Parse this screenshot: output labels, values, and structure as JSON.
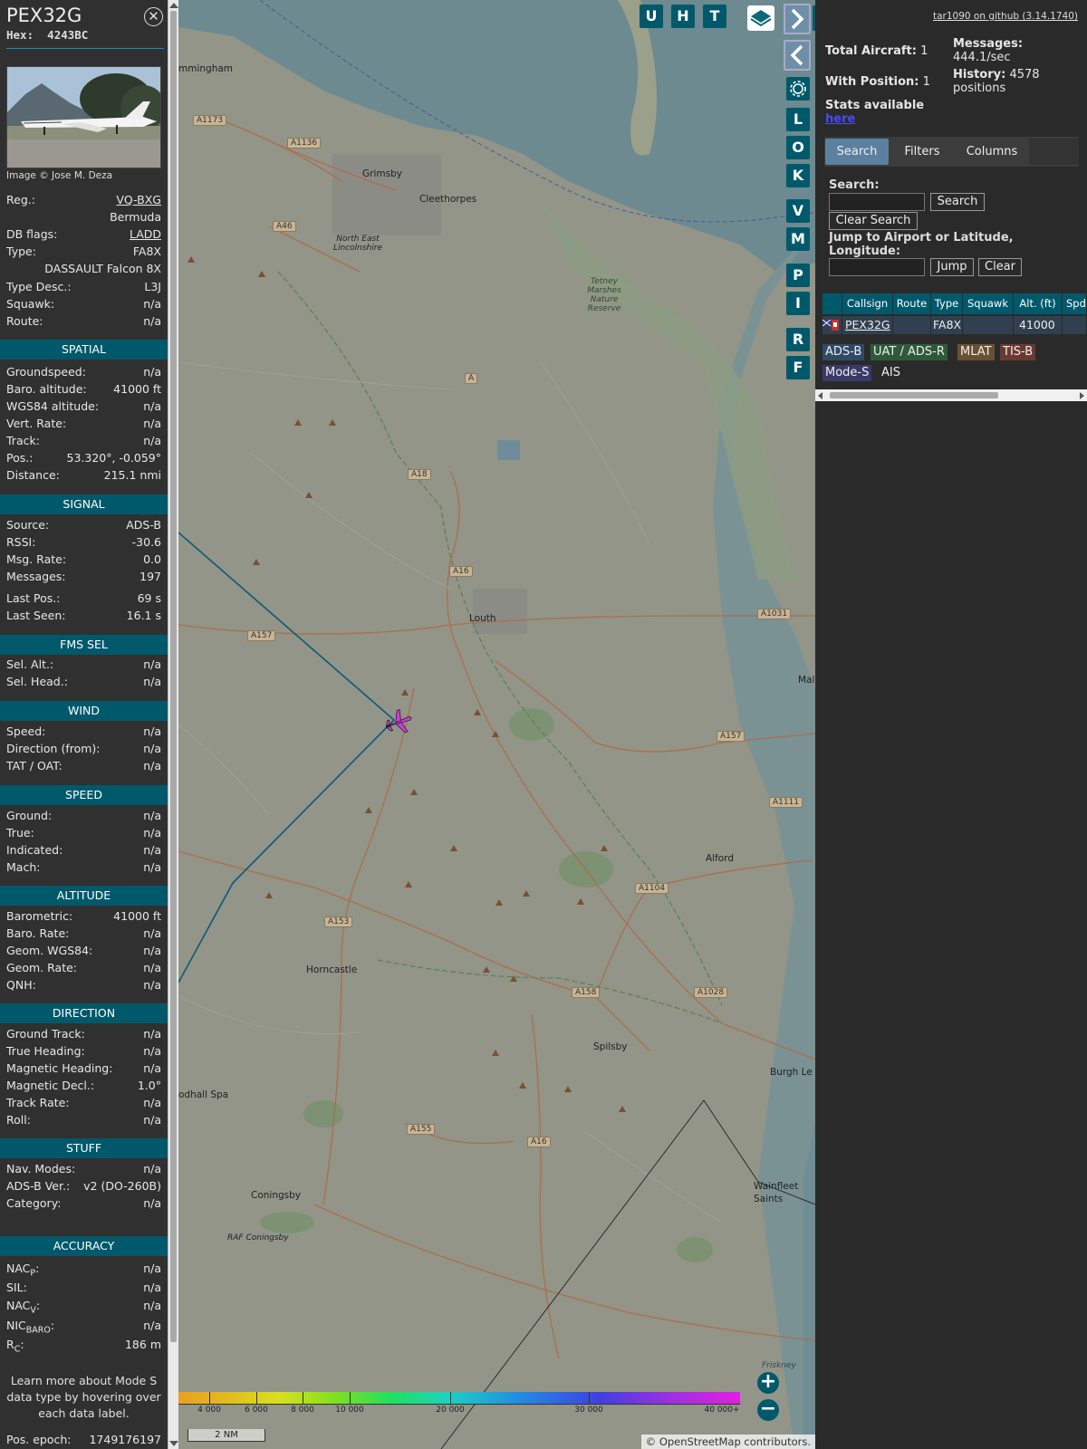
{
  "aircraft": {
    "callsign": "PEX32G",
    "hex_label": "Hex:",
    "hex": "4243BC",
    "photo_credit": "Image © Jose M. Deza",
    "close_icon": "close-circle-icon"
  },
  "info_rows_top": [
    {
      "label": "Reg.:",
      "value": "VQ-BXG",
      "link": true
    },
    {
      "label": "",
      "value": "Bermuda"
    },
    {
      "label": "DB flags:",
      "value": "LADD",
      "link": true
    },
    {
      "label": "Type:",
      "value": "FA8X"
    },
    {
      "label": "",
      "value": "DASSAULT Falcon 8X"
    },
    {
      "label": "Type Desc.:",
      "value": "L3J"
    },
    {
      "label": "Squawk:",
      "value": "n/a"
    },
    {
      "label": "Route:",
      "value": "n/a"
    }
  ],
  "sections": [
    {
      "title": "SPATIAL",
      "rows": [
        {
          "label": "Groundspeed:",
          "value": "n/a"
        },
        {
          "label": "Baro. altitude:",
          "value": "41000 ft"
        },
        {
          "label": "WGS84 altitude:",
          "value": "n/a"
        },
        {
          "label": "Vert. Rate:",
          "value": "n/a"
        },
        {
          "label": "Track:",
          "value": "n/a"
        },
        {
          "label": "Pos.:",
          "value": "53.320°, -0.059°"
        },
        {
          "label": "Distance:",
          "value": "215.1 nmi"
        }
      ]
    },
    {
      "title": "SIGNAL",
      "rows": [
        {
          "label": "Source:",
          "value": "ADS-B"
        },
        {
          "label": "RSSI:",
          "value": "-30.6"
        },
        {
          "label": "Msg. Rate:",
          "value": "0.0"
        },
        {
          "label": "Messages:",
          "value": "197"
        },
        {
          "label": "Last Pos.:",
          "value": "69 s"
        },
        {
          "label": "Last Seen:",
          "value": "16.1 s"
        }
      ]
    },
    {
      "title": "FMS SEL",
      "rows": [
        {
          "label": "Sel. Alt.:",
          "value": "n/a"
        },
        {
          "label": "Sel. Head.:",
          "value": "n/a"
        }
      ]
    },
    {
      "title": "WIND",
      "rows": [
        {
          "label": "Speed:",
          "value": "n/a"
        },
        {
          "label": "Direction (from):",
          "value": "n/a"
        },
        {
          "label": "TAT / OAT:",
          "value": "n/a"
        }
      ]
    },
    {
      "title": "SPEED",
      "rows": [
        {
          "label": "Ground:",
          "value": "n/a"
        },
        {
          "label": "True:",
          "value": "n/a"
        },
        {
          "label": "Indicated:",
          "value": "n/a"
        },
        {
          "label": "Mach:",
          "value": "n/a"
        }
      ]
    },
    {
      "title": "ALTITUDE",
      "rows": [
        {
          "label": "Barometric:",
          "value": "41000 ft"
        },
        {
          "label": "Baro. Rate:",
          "value": "n/a"
        },
        {
          "label": "Geom. WGS84:",
          "value": "n/a"
        },
        {
          "label": "Geom. Rate:",
          "value": "n/a"
        },
        {
          "label": "QNH:",
          "value": "n/a"
        }
      ]
    },
    {
      "title": "DIRECTION",
      "rows": [
        {
          "label": "Ground Track:",
          "value": "n/a"
        },
        {
          "label": "True Heading:",
          "value": "n/a"
        },
        {
          "label": "Magnetic Heading:",
          "value": "n/a"
        },
        {
          "label": "Magnetic Decl.:",
          "value": "1.0°"
        },
        {
          "label": "Track Rate:",
          "value": "n/a"
        },
        {
          "label": "Roll:",
          "value": "n/a"
        }
      ]
    },
    {
      "title": "STUFF",
      "rows": [
        {
          "label": "Nav. Modes:",
          "value": "n/a"
        },
        {
          "label": "ADS-B Ver.:",
          "value": "v2 (DO-260B)"
        },
        {
          "label": "Category:",
          "value": "n/a"
        }
      ]
    }
  ],
  "accuracy": {
    "title": "ACCURACY",
    "rows": [
      {
        "label_main": "NAC",
        "label_sub": "P",
        "value": "n/a"
      },
      {
        "label_main": "SIL",
        "label_sub": "",
        "value": "n/a"
      },
      {
        "label_main": "NAC",
        "label_sub": "V",
        "value": "n/a"
      },
      {
        "label_main": "NIC",
        "label_sub": "BARO",
        "value": "n/a"
      },
      {
        "label_main": "R",
        "label_sub": "C",
        "value": "186 m"
      }
    ]
  },
  "learn_more": "Learn more about Mode S data type by hovering over each data label.",
  "pos_epoch": {
    "label": "Pos. epoch:",
    "value": "1749176197"
  },
  "map": {
    "top_buttons": [
      "U",
      "H",
      "T"
    ],
    "side_buttons": [
      "L",
      "O",
      "K",
      "V",
      "M",
      "P",
      "I",
      "R",
      "F"
    ],
    "towns": [
      "mmingham",
      "Grimsby",
      "Cleethorpes",
      "North East Lincolnshire",
      "Tetney Marshes Nature Reserve",
      "Louth",
      "Alford",
      "Horncastle",
      "Spilsby",
      "Burgh Le",
      "Coningsby",
      "RAF Coningsby",
      "odhall Spa",
      "Wainfleet Saints",
      "Mal",
      "Friskney"
    ],
    "roads": [
      "A1173",
      "A1136",
      "A46",
      "A",
      "A18",
      "A16",
      "A157",
      "A1031",
      "A157",
      "A1111",
      "A1104",
      "A153",
      "A158",
      "A1028",
      "A155",
      "A16"
    ],
    "altitude_legend": [
      "4 000",
      "6 000",
      "8 000",
      "10 000",
      "20 000",
      "30 000",
      "40 000+"
    ],
    "scale": "2 NM",
    "attribution": "© OpenStreetMap contributors.",
    "zoom_in": "+",
    "zoom_out": "−"
  },
  "sidebar": {
    "github_link": "tar1090 on github (3.14.1740)",
    "total_aircraft_label": "Total Aircraft:",
    "total_aircraft": "1",
    "with_position_label": "With Position:",
    "with_position": "1",
    "messages_label": "Messages:",
    "messages_value": "444.1/sec",
    "history_label": "History:",
    "history_value": "4578 positions",
    "stats_text": "Stats available",
    "stats_link": "here",
    "tabs": [
      "Search",
      "Filters",
      "Columns"
    ],
    "search_label": "Search:",
    "search_button": "Search",
    "clear_search_button": "Clear Search",
    "jump_label": "Jump to Airport or Latitude, Longitude:",
    "jump_button": "Jump",
    "clear_button": "Clear",
    "table_headers": [
      "",
      "Callsign",
      "Route",
      "Type",
      "Squawk",
      "Alt. (ft)",
      "Spd."
    ],
    "table_rows": [
      {
        "flag": "flag-icon",
        "callsign": "PEX32G",
        "route": "",
        "type": "FA8X",
        "squawk": "",
        "alt": "41000",
        "spd": ""
      }
    ],
    "source_chips": [
      {
        "label": "ADS-B",
        "color": "#2e4a66"
      },
      {
        "label": "UAT / ADS-R",
        "color": "#2f5a3a"
      },
      {
        "label": "MLAT",
        "color": "#6a5030"
      },
      {
        "label": "TIS-B",
        "color": "#6a3a32"
      },
      {
        "label": "Mode-S",
        "color": "#3a3a6a"
      },
      {
        "label": "AIS",
        "color": "#2a2a2a"
      }
    ]
  }
}
